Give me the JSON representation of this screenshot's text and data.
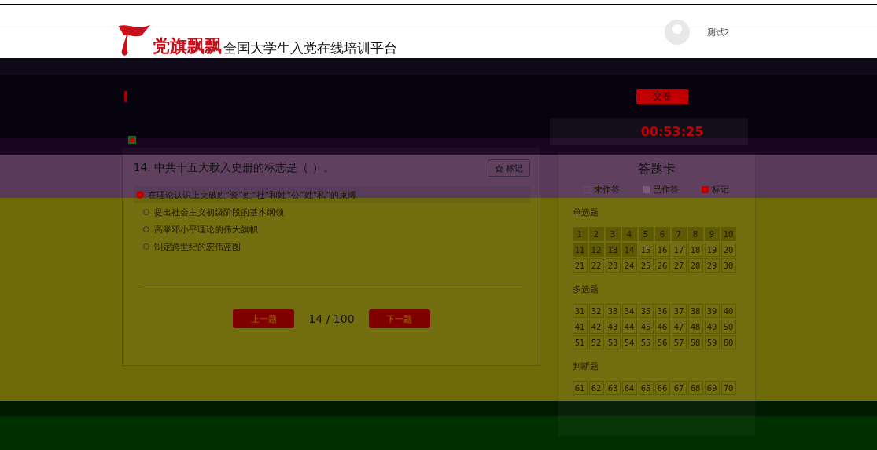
{
  "header": {
    "logo_text": "党旗飘飘",
    "platform_title": "全国大学生入党在线培训平台",
    "user_name": "测试2"
  },
  "toolbar": {
    "submit_button": "交卷"
  },
  "question": {
    "title": "14. 中共十五大载入史册的标志是（ ）。",
    "mark_button": "标记",
    "options": [
      {
        "text": "在理论认识上突破姓“资”姓“社”和姓“公”姓“私”的束缚",
        "selected": true
      },
      {
        "text": "提出社会主义初级阶段的基本纲领",
        "selected": false
      },
      {
        "text": "高举邓小平理论的伟大旗帜",
        "selected": false
      },
      {
        "text": "制定跨世纪的宏伟蓝图",
        "selected": false
      }
    ]
  },
  "pager": {
    "prev_button": "上一题",
    "position": "14 / 100",
    "next_button": "下一题"
  },
  "timer": {
    "value": "00:53:25"
  },
  "answer_card": {
    "title": "答题卡",
    "legend": [
      {
        "label": "未作答",
        "kind": "unanswered"
      },
      {
        "label": "已作答",
        "kind": "answered"
      },
      {
        "label": "标记",
        "kind": "marked"
      }
    ],
    "sections": [
      {
        "title": "单选题",
        "items": [
          {
            "n": "1",
            "answered": true
          },
          {
            "n": "2",
            "answered": true
          },
          {
            "n": "3",
            "answered": true
          },
          {
            "n": "4",
            "answered": true
          },
          {
            "n": "5",
            "answered": true
          },
          {
            "n": "6",
            "answered": true
          },
          {
            "n": "7",
            "answered": true
          },
          {
            "n": "8",
            "answered": true
          },
          {
            "n": "9",
            "answered": true
          },
          {
            "n": "10",
            "answered": true
          },
          {
            "n": "11",
            "answered": true
          },
          {
            "n": "12",
            "answered": true
          },
          {
            "n": "13",
            "answered": true
          },
          {
            "n": "14",
            "answered": true
          },
          {
            "n": "15",
            "answered": false
          },
          {
            "n": "16",
            "answered": false
          },
          {
            "n": "17",
            "answered": false
          },
          {
            "n": "18",
            "answered": false
          },
          {
            "n": "19",
            "answered": false
          },
          {
            "n": "20",
            "answered": false
          },
          {
            "n": "21",
            "answered": false
          },
          {
            "n": "22",
            "answered": false
          },
          {
            "n": "23",
            "answered": false
          },
          {
            "n": "24",
            "answered": false
          },
          {
            "n": "25",
            "answered": false
          },
          {
            "n": "26",
            "answered": false
          },
          {
            "n": "27",
            "answered": false
          },
          {
            "n": "28",
            "answered": false
          },
          {
            "n": "29",
            "answered": false
          },
          {
            "n": "30",
            "answered": false
          }
        ]
      },
      {
        "title": "多选题",
        "items": [
          {
            "n": "31",
            "answered": false
          },
          {
            "n": "32",
            "answered": false
          },
          {
            "n": "33",
            "answered": false
          },
          {
            "n": "34",
            "answered": false
          },
          {
            "n": "35",
            "answered": false
          },
          {
            "n": "36",
            "answered": false
          },
          {
            "n": "37",
            "answered": false
          },
          {
            "n": "38",
            "answered": false
          },
          {
            "n": "39",
            "answered": false
          },
          {
            "n": "40",
            "answered": false
          },
          {
            "n": "41",
            "answered": false
          },
          {
            "n": "42",
            "answered": false
          },
          {
            "n": "43",
            "answered": false
          },
          {
            "n": "44",
            "answered": false
          },
          {
            "n": "45",
            "answered": false
          },
          {
            "n": "46",
            "answered": false
          },
          {
            "n": "47",
            "answered": false
          },
          {
            "n": "48",
            "answered": false
          },
          {
            "n": "49",
            "answered": false
          },
          {
            "n": "50",
            "answered": false
          },
          {
            "n": "51",
            "answered": false
          },
          {
            "n": "52",
            "answered": false
          },
          {
            "n": "53",
            "answered": false
          },
          {
            "n": "54",
            "answered": false
          },
          {
            "n": "55",
            "answered": false
          },
          {
            "n": "56",
            "answered": false
          },
          {
            "n": "57",
            "answered": false
          },
          {
            "n": "58",
            "answered": false
          },
          {
            "n": "59",
            "answered": false
          },
          {
            "n": "60",
            "answered": false
          }
        ]
      },
      {
        "title": "判断题",
        "items": [
          {
            "n": "61",
            "answered": false
          },
          {
            "n": "62",
            "answered": false
          },
          {
            "n": "63",
            "answered": false
          },
          {
            "n": "64",
            "answered": false
          },
          {
            "n": "65",
            "answered": false
          },
          {
            "n": "66",
            "answered": false
          },
          {
            "n": "67",
            "answered": false
          },
          {
            "n": "68",
            "answered": false
          },
          {
            "n": "69",
            "answered": false
          },
          {
            "n": "70",
            "answered": false
          }
        ]
      }
    ]
  }
}
